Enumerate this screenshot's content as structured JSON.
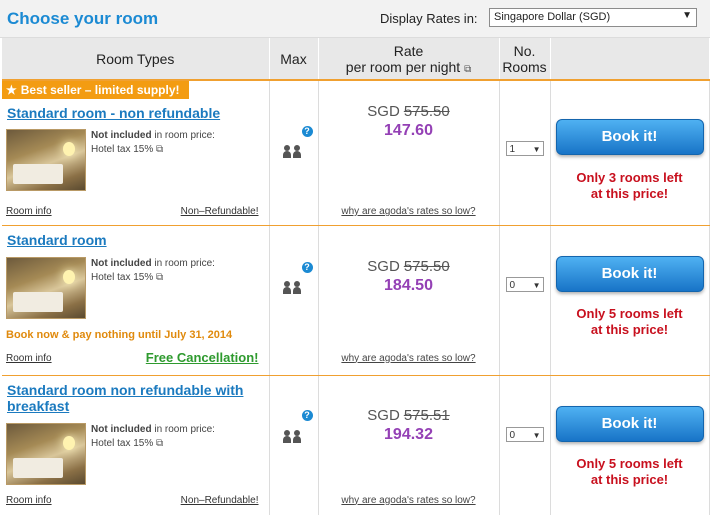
{
  "header": {
    "title": "Choose your room",
    "rates_label": "Display Rates in:",
    "currency_selected": "Singapore Dollar (SGD)"
  },
  "columns": {
    "room_types": "Room Types",
    "max": "Max",
    "rate_line1": "Rate",
    "rate_line2": "per room per night",
    "rooms_line1": "No.",
    "rooms_line2": "Rooms"
  },
  "rooms": [
    {
      "badge": "Best seller – limited supply!",
      "name": "Standard room - non refundable",
      "not_included": "Not included",
      "tax_note": "in room price:",
      "tax": "Hotel tax 15%",
      "room_info": "Room info",
      "policy": "Non–Refundable!",
      "currency": "SGD",
      "old_rate": "575.50",
      "new_rate": "147.60",
      "why_low": "why are agoda's rates so low?",
      "qty": "1",
      "book": "Book it!",
      "left_line1": "Only 3 rooms left",
      "left_line2": "at this price!"
    },
    {
      "name": "Standard room",
      "not_included": "Not included",
      "tax_note": "in room price:",
      "tax": "Hotel tax 15%",
      "book_now": "Book now & pay nothing until July 31, 2014",
      "room_info": "Room info",
      "policy": "Free Cancellation!",
      "currency": "SGD",
      "old_rate": "575.50",
      "new_rate": "184.50",
      "why_low": "why are agoda's rates so low?",
      "qty": "0",
      "book": "Book it!",
      "left_line1": "Only 5 rooms left",
      "left_line2": "at this price!"
    },
    {
      "name": "Standard room non refundable with breakfast",
      "not_included": "Not included",
      "tax_note": "in room price:",
      "tax": "Hotel tax 15%",
      "room_info": "Room info",
      "policy": "Non–Refundable!",
      "currency": "SGD",
      "old_rate": "575.51",
      "new_rate": "194.32",
      "why_low": "why are agoda's rates so low?",
      "qty": "0",
      "book": "Book it!",
      "left_line1": "Only 5 rooms left",
      "left_line2": "at this price!"
    }
  ],
  "icons": {
    "star": "star-icon",
    "people": "people-icon",
    "help": "help-icon",
    "external": "external-link-icon"
  },
  "colors": {
    "accent_blue": "#1b8ad3",
    "orange": "#f39c12",
    "purple_rate": "#9440b5",
    "red_notice": "#c8101e",
    "green": "#2e9a2e"
  }
}
